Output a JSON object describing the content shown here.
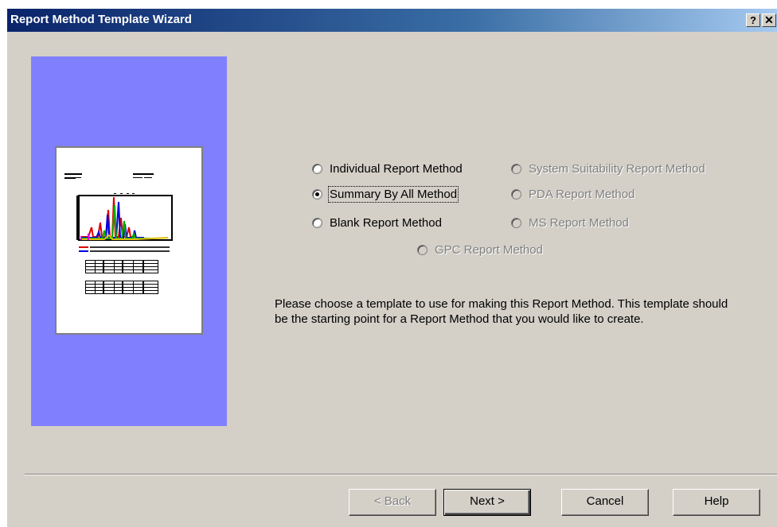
{
  "window": {
    "title": "Report Method Template Wizard",
    "help_glyph": "?",
    "close_glyph": "✕"
  },
  "options": [
    {
      "label": "Individual Report Method",
      "accel": "I",
      "checked": false,
      "enabled": true
    },
    {
      "label": "Summary By All Method",
      "accel": "S",
      "checked": true,
      "enabled": true
    },
    {
      "label": "Blank Report Method",
      "accel": "R",
      "checked": false,
      "enabled": true
    },
    {
      "label": "System Suitability Report Method",
      "accel": "y",
      "checked": false,
      "enabled": false
    },
    {
      "label": "PDA Report Method",
      "accel": "P",
      "checked": false,
      "enabled": false
    },
    {
      "label": "MS Report Method",
      "accel": "M",
      "checked": false,
      "enabled": false
    },
    {
      "label": "GPC Report Method",
      "accel": "G",
      "checked": false,
      "enabled": false
    }
  ],
  "description": "Please choose a template to use for making this Report Method.  This template should be the starting point for a Report Method that you would like to create.",
  "buttons": {
    "back": "< Back",
    "next": "Next >",
    "cancel": "Cancel",
    "help": "Help"
  },
  "colors": {
    "side_panel": "#8080ff",
    "title_bar": "#0a246a",
    "dialog_bg": "#d4d0c8"
  },
  "icons": [
    "help-icon",
    "close-icon",
    "report-preview-thumbnail"
  ]
}
